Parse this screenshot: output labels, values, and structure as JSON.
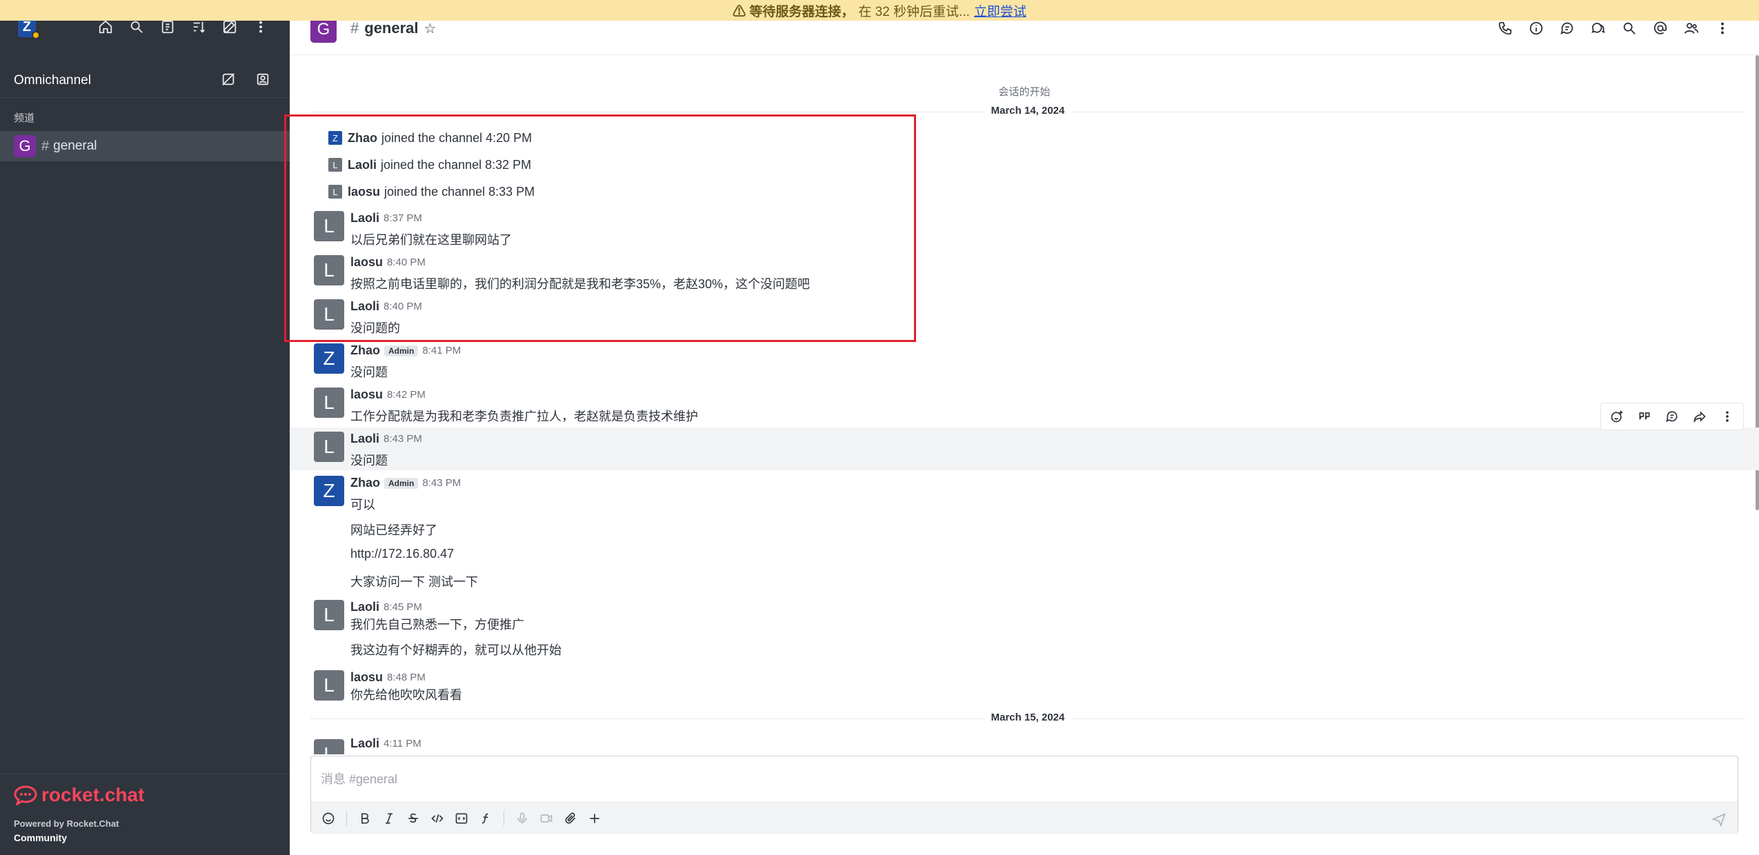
{
  "banner": {
    "warn": "⚠ 等待服务器连接，",
    "countdown": "在 32 秒钟后重试...",
    "retry": "立即尝试"
  },
  "sidebar": {
    "user_initial": "Z",
    "section_title": "Omnichannel",
    "channels_label": "频道",
    "room": {
      "initial": "G",
      "name": "general"
    },
    "logo_text": "rocket.chat",
    "powered_by": "Powered by Rocket.Chat",
    "edition": "Community"
  },
  "header": {
    "initial": "G",
    "title": "general",
    "star": "☆"
  },
  "chat": {
    "start_label": "会话的开始",
    "date1": "March 14, 2024",
    "date2": "March 15, 2024",
    "joins": [
      {
        "initial": "Z",
        "name": "Zhao",
        "text": "joined the channel 4:20 PM",
        "color": "#1d4fa5"
      },
      {
        "initial": "L",
        "name": "Laoli",
        "text": "joined the channel 8:32 PM",
        "color": "#6c727a"
      },
      {
        "initial": "L",
        "name": "laosu",
        "text": "joined the channel 8:33 PM",
        "color": "#6c727a"
      }
    ],
    "messages": [
      {
        "initial": "L",
        "name": "Laoli",
        "badge": "",
        "time": "8:37 PM",
        "lines": [
          "以后兄弟们就在这里聊网站了"
        ]
      },
      {
        "initial": "L",
        "name": "laosu",
        "badge": "",
        "time": "8:40 PM",
        "lines": [
          "按照之前电话里聊的，我们的利润分配就是我和老李35%，老赵30%，这个没问题吧"
        ]
      },
      {
        "initial": "L",
        "name": "Laoli",
        "badge": "",
        "time": "8:40 PM",
        "lines": [
          "没问题的"
        ]
      },
      {
        "initial": "Z",
        "name": "Zhao",
        "badge": "Admin",
        "time": "8:41 PM",
        "lines": [
          "没问题"
        ]
      },
      {
        "initial": "L",
        "name": "laosu",
        "badge": "",
        "time": "8:42 PM",
        "lines": [
          "工作分配就是为我和老李负责推广拉人，老赵就是负责技术维护"
        ]
      },
      {
        "initial": "L",
        "name": "Laoli",
        "badge": "",
        "time": "8:43 PM",
        "lines": [
          "没问题"
        ]
      },
      {
        "initial": "Z",
        "name": "Zhao",
        "badge": "Admin",
        "time": "8:43 PM",
        "lines": [
          "可以",
          "网站已经弄好了",
          "http://172.16.80.47",
          "大家访问一下 测试一下"
        ]
      },
      {
        "initial": "L",
        "name": "Laoli",
        "badge": "",
        "time": "8:45 PM",
        "lines": [
          "我们先自己熟悉一下，方便推广",
          "我这边有个好糊弄的，就可以从他开始"
        ]
      },
      {
        "initial": "L",
        "name": "laosu",
        "badge": "",
        "time": "8:48 PM",
        "lines": [
          "你先给他吹吹风看看"
        ]
      },
      {
        "initial": "L",
        "name": "Laoli",
        "badge": "",
        "time": "4:11 PM",
        "lines": []
      }
    ]
  },
  "composer": {
    "placeholder": "消息 #general"
  },
  "colors": {
    "sidebar_bg": "#2f343d",
    "room_avatar": "#7b2d9e",
    "zhao_avatar": "#1d4fa5",
    "default_avatar": "#6c727a",
    "highlight": "#e0202c",
    "banner": "#fbe5a5"
  }
}
